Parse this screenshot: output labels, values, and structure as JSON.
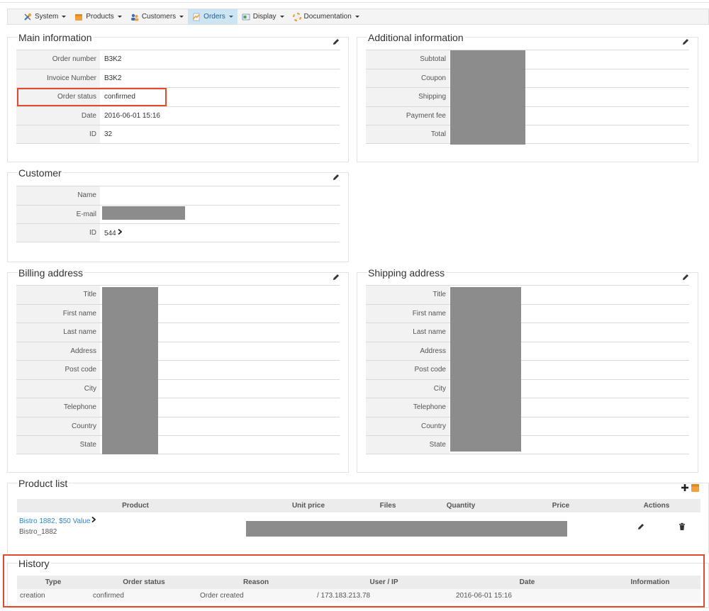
{
  "nav": {
    "items": [
      {
        "label": "System",
        "icon": "tools-icon"
      },
      {
        "label": "Products",
        "icon": "box-icon"
      },
      {
        "label": "Customers",
        "icon": "users-icon"
      },
      {
        "label": "Orders",
        "icon": "orders-icon"
      },
      {
        "label": "Display",
        "icon": "display-icon"
      },
      {
        "label": "Documentation",
        "icon": "help-icon"
      }
    ],
    "active": "Orders"
  },
  "main_info": {
    "title": "Main information",
    "rows": [
      {
        "key": "Order number",
        "value": "B3K2"
      },
      {
        "key": "Invoice Number",
        "value": "B3K2"
      },
      {
        "key": "Order status",
        "value": "confirmed"
      },
      {
        "key": "Date",
        "value": "2016-06-01 15:16"
      },
      {
        "key": "ID",
        "value": "32"
      }
    ]
  },
  "additional_info": {
    "title": "Additional information",
    "rows": [
      {
        "key": "Subtotal"
      },
      {
        "key": "Coupon"
      },
      {
        "key": "Shipping"
      },
      {
        "key": "Payment fee"
      },
      {
        "key": "Total"
      }
    ]
  },
  "customer": {
    "title": "Customer",
    "rows": [
      {
        "key": "Name",
        "value": ""
      },
      {
        "key": "E-mail",
        "value": ""
      },
      {
        "key": "ID",
        "value": "544"
      }
    ]
  },
  "billing": {
    "title": "Billing address",
    "rows": [
      "Title",
      "First name",
      "Last name",
      "Address",
      "Post code",
      "City",
      "Telephone",
      "Country",
      "State"
    ]
  },
  "shipping": {
    "title": "Shipping address",
    "rows": [
      "Title",
      "First name",
      "Last name",
      "Address",
      "Post code",
      "City",
      "Telephone",
      "Country",
      "State"
    ]
  },
  "products": {
    "title": "Product list",
    "columns": [
      "Product",
      "Unit price",
      "Files",
      "Quantity",
      "Price",
      "Actions"
    ],
    "items": [
      {
        "name": "Bistro 1882, $50 Value",
        "code": "Bistro_1882"
      }
    ]
  },
  "history": {
    "title": "History",
    "columns": [
      "Type",
      "Order status",
      "Reason",
      "User / IP",
      "Date",
      "Information"
    ],
    "rows": [
      {
        "type": "creation",
        "status": "confirmed",
        "reason": "Order created",
        "user_ip": "/ 173.183.213.78",
        "date": "2016-06-01 15:16",
        "info": ""
      }
    ]
  },
  "colors": {
    "highlight": "#e04b2e",
    "link": "#2e86c1",
    "active_nav": "#cde4f2",
    "redaction": "#8c8c8c"
  }
}
